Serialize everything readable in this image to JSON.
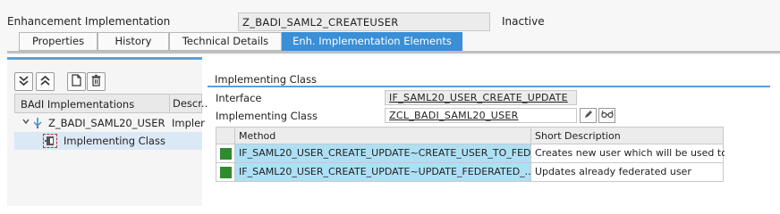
{
  "header": {
    "enh_impl_label": "Enhancement Implementation",
    "enh_impl_value": "Z_BADI_SAML2_CREATEUSER",
    "status": "Inactive"
  },
  "tabs": [
    {
      "label": "Properties",
      "active": false
    },
    {
      "label": "History",
      "active": false
    },
    {
      "label": "Technical Details",
      "active": false
    },
    {
      "label": "Enh. Implementation Elements",
      "active": true
    }
  ],
  "toolbar": {
    "icons": [
      "expand-all-icon",
      "collapse-all-icon",
      "new-document-icon",
      "delete-icon"
    ]
  },
  "tree": {
    "columns": [
      "BAdI Implementations",
      "Descr..."
    ],
    "rows": [
      {
        "label": "Z_BADI_SAML20_USER",
        "descr": "Impler"
      },
      {
        "label": "Implementing Class",
        "descr": ""
      }
    ]
  },
  "detail": {
    "section_title": "Implementing Class",
    "interface_label": "Interface",
    "interface_value": "IF_SAML20_USER_CREATE_UPDATE",
    "impl_class_label": "Implementing Class",
    "impl_class_value": "ZCL_BADI_SAML20_USER",
    "icons": [
      "pencil-icon",
      "glasses-icon"
    ]
  },
  "methods": {
    "columns": [
      "Method",
      "Short Description"
    ],
    "rows": [
      {
        "method": "IF_SAML20_USER_CREATE_UPDATE~CREATE_USER_TO_FED...",
        "desc": "Creates new user which will be used to..."
      },
      {
        "method": "IF_SAML20_USER_CREATE_UPDATE~UPDATE_FEDERATED_...",
        "desc": "Updates already federated user"
      }
    ]
  },
  "colors": {
    "accent": "#3a8fd6",
    "row_highlight": "#aee0f5",
    "status_green": "#2e8b2e"
  }
}
